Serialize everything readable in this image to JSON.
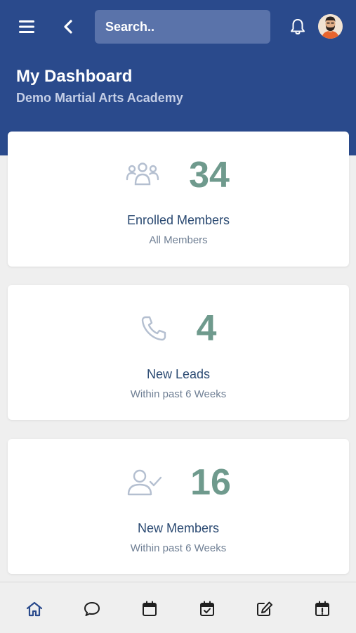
{
  "header": {
    "search_placeholder": "Search..",
    "title": "My Dashboard",
    "subtitle": "Demo Martial Arts Academy"
  },
  "cards": [
    {
      "icon": "people-group-icon",
      "value": "34",
      "label": "Enrolled Members",
      "sublabel": "All Members"
    },
    {
      "icon": "phone-icon",
      "value": "4",
      "label": "New Leads",
      "sublabel": "Within past 6 Weeks"
    },
    {
      "icon": "user-check-icon",
      "value": "16",
      "label": "New Members",
      "sublabel": "Within past 6 Weeks"
    }
  ],
  "bottom_nav": [
    {
      "icon": "home-icon",
      "active": true
    },
    {
      "icon": "chat-icon",
      "active": false
    },
    {
      "icon": "calendar-icon",
      "active": false
    },
    {
      "icon": "calendar-check-icon",
      "active": false
    },
    {
      "icon": "edit-icon",
      "active": false
    },
    {
      "icon": "calendar-alert-icon",
      "active": false
    }
  ],
  "colors": {
    "header_bg": "#2a4a8c",
    "search_bg": "#5a73aa",
    "stat_value": "#6f9a8d",
    "label_text": "#2b4a72",
    "icon_muted": "#b4bfd0",
    "nav_active": "#2a4a8c",
    "nav_icon": "#1f1f1f"
  }
}
